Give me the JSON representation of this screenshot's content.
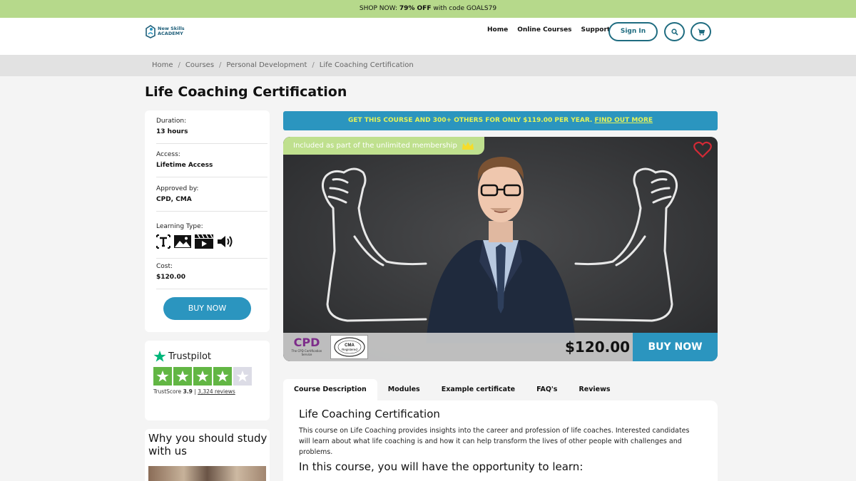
{
  "promo": {
    "prefix": "SHOP NOW: ",
    "bold": "79% OFF",
    "suffix": " with code GOALS79"
  },
  "header": {
    "logo_line1": "New Skills",
    "logo_line2": "ACADEMY",
    "nav": [
      "Home",
      "Online Courses",
      "Support"
    ],
    "signin_label": "Sign In"
  },
  "breadcrumb": [
    "Home",
    "Courses",
    "Personal Development",
    "Life Coaching Certification"
  ],
  "breadcrumb_sep": "/",
  "page_title": "Life Coaching Certification",
  "info": {
    "duration_label": "Duration:",
    "duration_value": "13 hours",
    "access_label": "Access:",
    "access_value": "Lifetime Access",
    "approved_label": "Approved by:",
    "approved_value": "CPD, CMA",
    "learning_label": "Learning Type:",
    "cost_label": "Cost:",
    "cost_value": "$120.00",
    "buy_label": "BUY NOW"
  },
  "trustpilot": {
    "brand": "Trustpilot",
    "score_label": "TrustScore",
    "score": "3.9",
    "separator": "|",
    "reviews": "3,324 reviews",
    "star_color": "#62b644"
  },
  "why": {
    "title": "Why you should study with us"
  },
  "membership_banner": {
    "text": "GET THIS COURSE AND 300+ OTHERS FOR ONLY $119.00 PER YEAR. ",
    "link": "FIND OUT MORE"
  },
  "hero": {
    "included_label": "Included as part of the unlimited membership",
    "cpd_text": "CPD",
    "cpd_sub": "The CPD Certification Service",
    "cma_line1": "COMPLEMENTARY",
    "cma_line2": "CMA",
    "cma_line3": "Registered",
    "cma_line4": "MEDICAL ASSOCIATION",
    "price": "$120.00",
    "buy_label": "BUY NOW"
  },
  "tabs": [
    "Course Description",
    "Modules",
    "Example certificate",
    "FAQ's",
    "Reviews"
  ],
  "content": {
    "title": "Life Coaching Certification",
    "paragraph": "This course on Life Coaching provides insights into the career and profession of life coaches. Interested candidates will learn about what life coaching is and how it can help transform the lives of other people with challenges and problems.",
    "subtitle": "In this course, you will have the opportunity to learn:"
  },
  "colors": {
    "accent": "#2b95bf",
    "promo_bg": "#b6d98b",
    "banner_text": "#e4f35a",
    "brand_dark": "#1f6c80"
  }
}
